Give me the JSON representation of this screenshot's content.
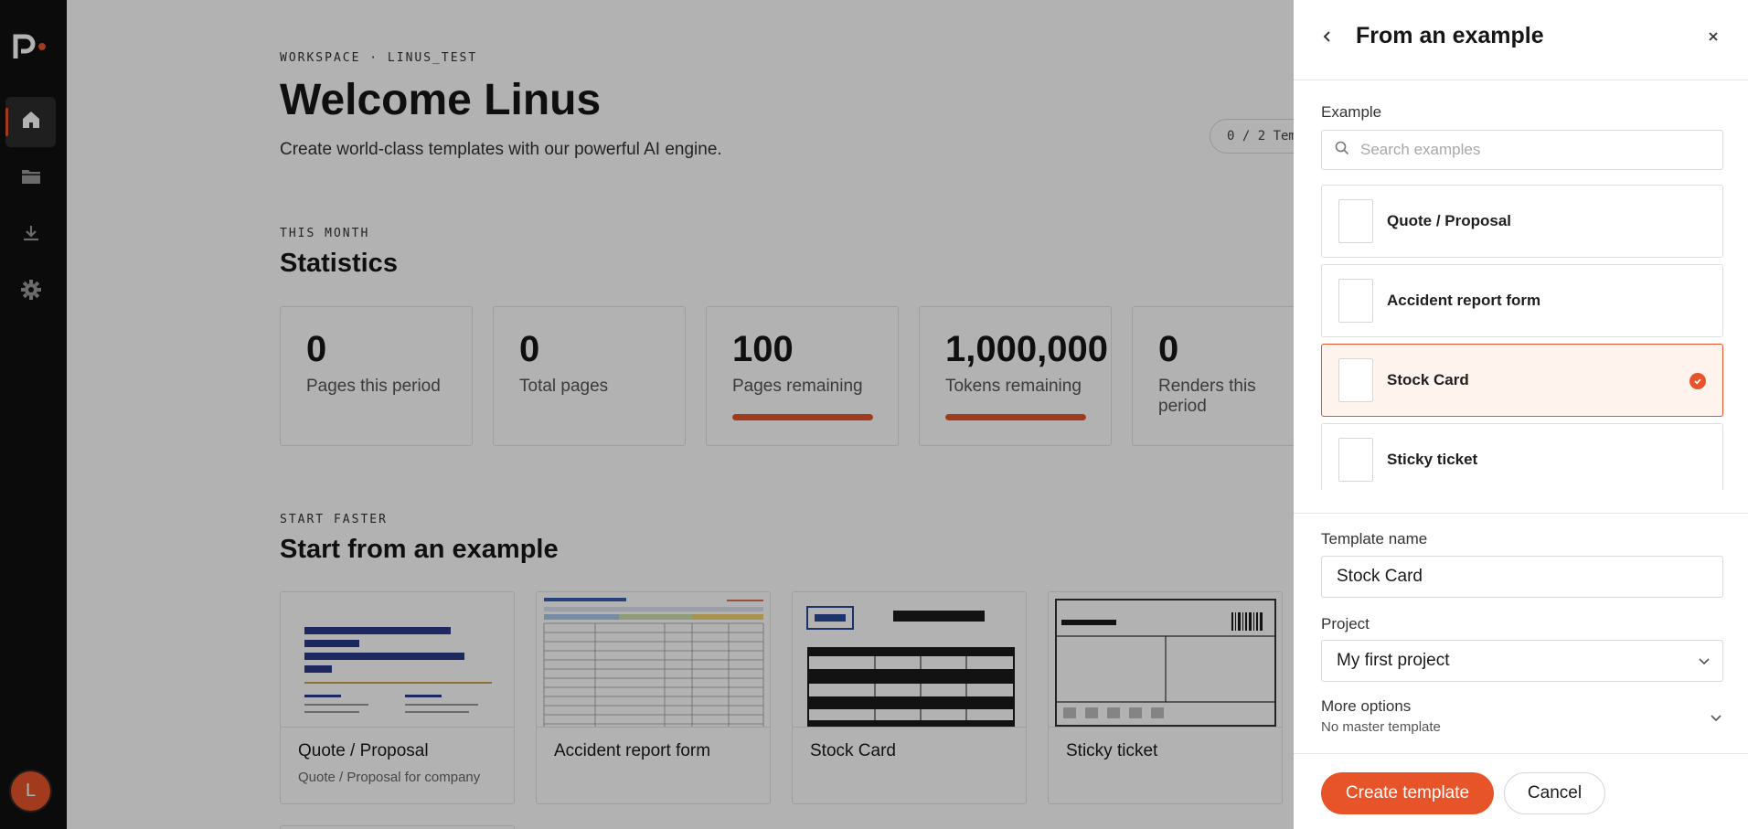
{
  "workspace": {
    "breadcrumb": "WORKSPACE · LINUS_TEST",
    "title": "Welcome Linus",
    "subtitle": "Create world-class templates with our powerful AI engine.",
    "templates_pill": "0 / 2 Tem"
  },
  "sidebar": {
    "items": [
      {
        "icon": "home-icon",
        "active": true
      },
      {
        "icon": "folder-icon",
        "active": false
      },
      {
        "icon": "download-icon",
        "active": false
      },
      {
        "icon": "gear-icon",
        "active": false
      }
    ],
    "avatar_initial": "L"
  },
  "statistics": {
    "eyebrow": "THIS MONTH",
    "title": "Statistics",
    "cards": [
      {
        "value": "0",
        "label": "Pages this period"
      },
      {
        "value": "0",
        "label": "Total pages"
      },
      {
        "value": "100",
        "label": "Pages remaining",
        "progress_percent": 100
      },
      {
        "value": "1,000,000",
        "label": "Tokens remaining",
        "progress_percent": 100
      },
      {
        "value": "0",
        "label": "Renders this period"
      }
    ]
  },
  "examples_section": {
    "eyebrow": "START FASTER",
    "title": "Start from an example",
    "cards": [
      {
        "title": "Quote / Proposal",
        "subtitle": "Quote / Proposal for company"
      },
      {
        "title": "Accident report form",
        "subtitle": ""
      },
      {
        "title": "Stock Card",
        "subtitle": ""
      },
      {
        "title": "Sticky ticket",
        "subtitle": ""
      }
    ]
  },
  "drawer": {
    "title": "From an example",
    "example_label": "Example",
    "search_placeholder": "Search examples",
    "items": [
      {
        "label": "Quote / Proposal",
        "selected": false
      },
      {
        "label": "Accident report form",
        "selected": false
      },
      {
        "label": "Stock Card",
        "selected": true
      },
      {
        "label": "Sticky ticket",
        "selected": false
      }
    ],
    "template_name_label": "Template name",
    "template_name_value": "Stock Card",
    "project_label": "Project",
    "project_value": "My first project",
    "more_options_title": "More options",
    "more_options_sub": "No master template",
    "create_label": "Create template",
    "cancel_label": "Cancel"
  },
  "colors": {
    "accent": "#e8542a",
    "sidebar_bg": "#111111"
  }
}
